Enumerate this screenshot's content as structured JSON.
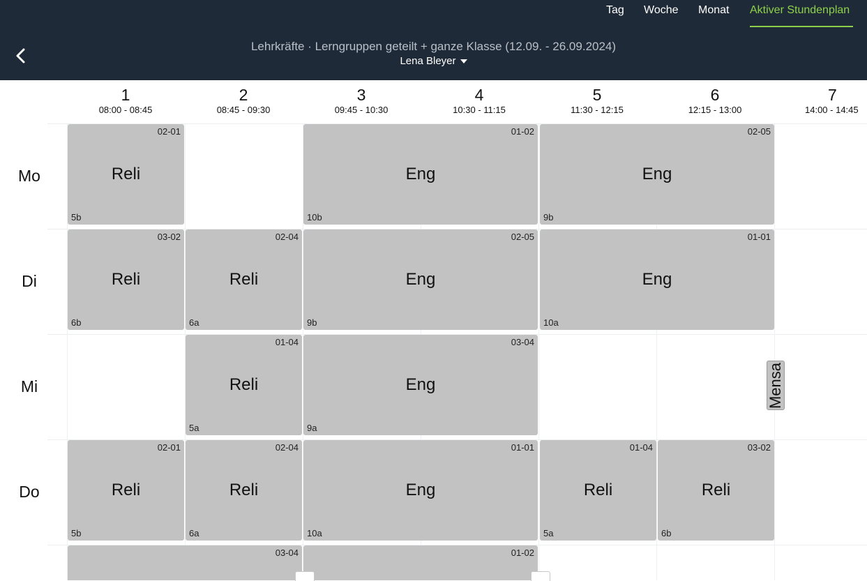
{
  "nav": {
    "day": "Tag",
    "week": "Woche",
    "month": "Monat",
    "active_schedule": "Aktiver Stundenplan"
  },
  "header": {
    "title": "Lehrkräfte · Lerngruppen geteilt + ganze Klasse (12.09. - 26.09.2024)",
    "teacher": "Lena Bleyer"
  },
  "periods": [
    {
      "num": "1",
      "time": "08:00 - 08:45"
    },
    {
      "num": "2",
      "time": "08:45 - 09:30"
    },
    {
      "num": "3",
      "time": "09:45 - 10:30"
    },
    {
      "num": "4",
      "time": "10:30 - 11:15"
    },
    {
      "num": "5",
      "time": "11:30 - 12:15"
    },
    {
      "num": "6",
      "time": "12:15 - 13:00"
    },
    {
      "num": "7",
      "time": "14:00 - 14:45"
    }
  ],
  "days": [
    "Mo",
    "Di",
    "Mi",
    "Do"
  ],
  "lessons": {
    "mo_1": {
      "room": "02-01",
      "subject": "Reli",
      "class": "5b"
    },
    "mo_34": {
      "room": "01-02",
      "subject": "Eng",
      "class": "10b"
    },
    "mo_56": {
      "room": "02-05",
      "subject": "Eng",
      "class": "9b"
    },
    "di_1": {
      "room": "03-02",
      "subject": "Reli",
      "class": "6b"
    },
    "di_2": {
      "room": "02-04",
      "subject": "Reli",
      "class": "6a"
    },
    "di_34": {
      "room": "02-05",
      "subject": "Eng",
      "class": "9b"
    },
    "di_56": {
      "room": "01-01",
      "subject": "Eng",
      "class": "10a"
    },
    "mi_2": {
      "room": "01-04",
      "subject": "Reli",
      "class": "5a"
    },
    "mi_34": {
      "room": "03-04",
      "subject": "Eng",
      "class": "9a"
    },
    "do_1": {
      "room": "02-01",
      "subject": "Reli",
      "class": "5b"
    },
    "do_2": {
      "room": "02-04",
      "subject": "Reli",
      "class": "6a"
    },
    "do_34": {
      "room": "01-01",
      "subject": "Eng",
      "class": "10a"
    },
    "do_5": {
      "room": "01-04",
      "subject": "Reli",
      "class": "5a"
    },
    "do_6": {
      "room": "03-02",
      "subject": "Reli",
      "class": "6b"
    },
    "fr_12": {
      "room": "03-04"
    },
    "fr_34": {
      "room": "01-02"
    }
  },
  "mensa": "Mensa"
}
